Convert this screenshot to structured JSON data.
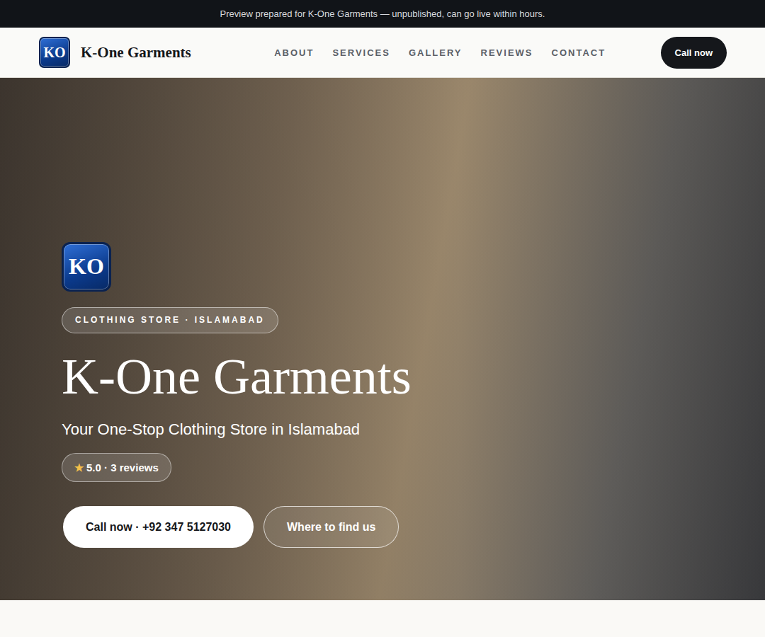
{
  "banner": {
    "text": "Preview prepared for K-One Garments — unpublished, can go live within hours."
  },
  "header": {
    "logo": "KO",
    "brand": "K-One Garments",
    "nav": [
      {
        "label": "ABOUT"
      },
      {
        "label": "SERVICES"
      },
      {
        "label": "GALLERY"
      },
      {
        "label": "REVIEWS"
      },
      {
        "label": "CONTACT"
      }
    ],
    "cta": "Call now"
  },
  "hero": {
    "logo": "KO",
    "badge": "CLOTHING STORE · ISLAMABAD",
    "title": "K-One Garments",
    "subtitle": "Your One-Stop Clothing Store in Islamabad",
    "rating": {
      "icon": "★",
      "label": "5.0 · 3 reviews"
    },
    "buttons": [
      {
        "label": "Call now · +92 347 5127030",
        "kind": "primary"
      },
      {
        "label": "Where to find us",
        "kind": "outline"
      }
    ]
  }
}
